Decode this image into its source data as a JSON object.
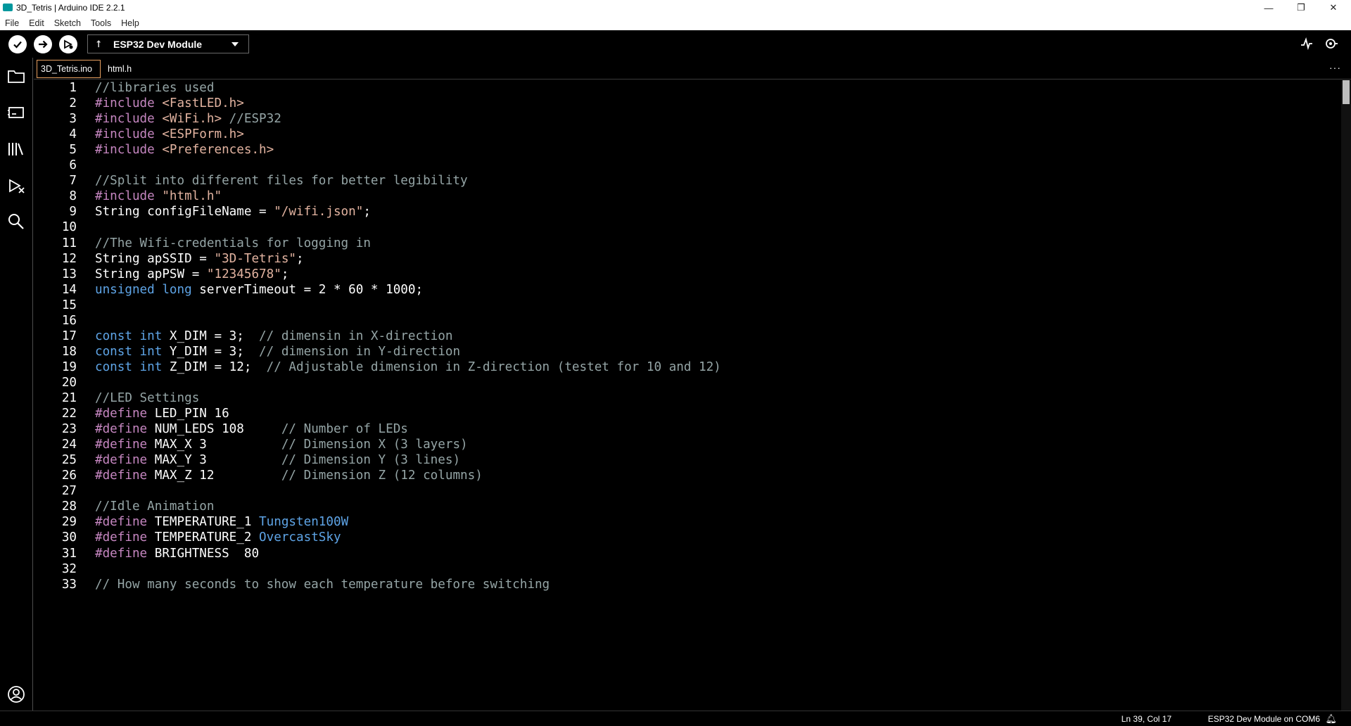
{
  "window": {
    "title": "3D_Tetris | Arduino IDE 2.2.1",
    "controls": {
      "minimize": "—",
      "maximize": "❐",
      "close": "✕"
    }
  },
  "menu": {
    "items": [
      "File",
      "Edit",
      "Sketch",
      "Tools",
      "Help"
    ]
  },
  "toolbar": {
    "verify_icon": "check-icon",
    "upload_icon": "arrow-right-icon",
    "debug_icon": "debug-icon",
    "board_label": "ESP32 Dev Module",
    "serial_plotter_icon": "plotter-icon",
    "serial_monitor_icon": "monitor-icon"
  },
  "sidebar": {
    "items": [
      "sketchbook-icon",
      "boards-manager-icon",
      "library-manager-icon",
      "debug-icon",
      "search-icon"
    ],
    "bottom": "account-icon"
  },
  "tabs": [
    {
      "label": "3D_Tetris.ino",
      "active": true
    },
    {
      "label": "html.h",
      "active": false
    }
  ],
  "tab_more": "···",
  "editor": {
    "lines": [
      {
        "n": "1",
        "t": [
          [
            "c",
            "//libraries used"
          ]
        ]
      },
      {
        "n": "2",
        "t": [
          [
            "p",
            "#include "
          ],
          [
            "s",
            "<FastLED.h>"
          ]
        ]
      },
      {
        "n": "3",
        "t": [
          [
            "p",
            "#include "
          ],
          [
            "s",
            "<WiFi.h>"
          ],
          [
            "c",
            " //ESP32"
          ]
        ]
      },
      {
        "n": "4",
        "t": [
          [
            "p",
            "#include "
          ],
          [
            "s",
            "<ESPForm.h>"
          ]
        ]
      },
      {
        "n": "5",
        "t": [
          [
            "p",
            "#include "
          ],
          [
            "s",
            "<Preferences.h>"
          ]
        ]
      },
      {
        "n": "6",
        "t": []
      },
      {
        "n": "7",
        "t": [
          [
            "c",
            "//Split into different files for better legibility"
          ]
        ]
      },
      {
        "n": "8",
        "t": [
          [
            "p",
            "#include "
          ],
          [
            "s",
            "\"html.h\""
          ]
        ]
      },
      {
        "n": "9",
        "t": [
          [
            "d",
            "String configFileName = "
          ],
          [
            "s",
            "\"/wifi.json\""
          ],
          [
            "d",
            ";"
          ]
        ]
      },
      {
        "n": "10",
        "t": []
      },
      {
        "n": "11",
        "t": [
          [
            "c",
            "//The Wifi-credentials for logging in"
          ]
        ]
      },
      {
        "n": "12",
        "t": [
          [
            "d",
            "String apSSID = "
          ],
          [
            "s",
            "\"3D-Tetris\""
          ],
          [
            "d",
            ";"
          ]
        ]
      },
      {
        "n": "13",
        "t": [
          [
            "d",
            "String apPSW = "
          ],
          [
            "s",
            "\"12345678\""
          ],
          [
            "d",
            ";"
          ]
        ]
      },
      {
        "n": "14",
        "t": [
          [
            "k",
            "unsigned long"
          ],
          [
            "d",
            " serverTimeout = 2 * 60 * 1000;"
          ]
        ]
      },
      {
        "n": "15",
        "t": []
      },
      {
        "n": "16",
        "t": []
      },
      {
        "n": "17",
        "t": [
          [
            "k",
            "const int"
          ],
          [
            "d",
            " X_DIM = 3;  "
          ],
          [
            "c",
            "// dimensin in X-direction"
          ]
        ]
      },
      {
        "n": "18",
        "t": [
          [
            "k",
            "const int"
          ],
          [
            "d",
            " Y_DIM = 3;  "
          ],
          [
            "c",
            "// dimension in Y-direction"
          ]
        ]
      },
      {
        "n": "19",
        "t": [
          [
            "k",
            "const int"
          ],
          [
            "d",
            " Z_DIM = 12;  "
          ],
          [
            "c",
            "// Adjustable dimension in Z-direction (testet for 10 and 12)"
          ]
        ]
      },
      {
        "n": "20",
        "t": []
      },
      {
        "n": "21",
        "t": [
          [
            "c",
            "//LED Settings"
          ]
        ]
      },
      {
        "n": "22",
        "t": [
          [
            "p",
            "#define"
          ],
          [
            "d",
            " LED_PIN 16"
          ]
        ]
      },
      {
        "n": "23",
        "t": [
          [
            "p",
            "#define"
          ],
          [
            "d",
            " NUM_LEDS 108     "
          ],
          [
            "c",
            "// Number of LEDs"
          ]
        ]
      },
      {
        "n": "24",
        "t": [
          [
            "p",
            "#define"
          ],
          [
            "d",
            " MAX_X 3          "
          ],
          [
            "c",
            "// Dimension X (3 layers)"
          ]
        ]
      },
      {
        "n": "25",
        "t": [
          [
            "p",
            "#define"
          ],
          [
            "d",
            " MAX_Y 3          "
          ],
          [
            "c",
            "// Dimension Y (3 lines)"
          ]
        ]
      },
      {
        "n": "26",
        "t": [
          [
            "p",
            "#define"
          ],
          [
            "d",
            " MAX_Z 12         "
          ],
          [
            "c",
            "// Dimension Z (12 columns)"
          ]
        ]
      },
      {
        "n": "27",
        "t": []
      },
      {
        "n": "28",
        "t": [
          [
            "c",
            "//Idle Animation"
          ]
        ]
      },
      {
        "n": "29",
        "t": [
          [
            "p",
            "#define"
          ],
          [
            "d",
            " TEMPERATURE_1 "
          ],
          [
            "h",
            "Tungsten100W"
          ]
        ]
      },
      {
        "n": "30",
        "t": [
          [
            "p",
            "#define"
          ],
          [
            "d",
            " TEMPERATURE_2 "
          ],
          [
            "h",
            "OvercastSky"
          ]
        ]
      },
      {
        "n": "31",
        "t": [
          [
            "p",
            "#define"
          ],
          [
            "d",
            " BRIGHTNESS  80"
          ]
        ]
      },
      {
        "n": "32",
        "t": []
      },
      {
        "n": "33",
        "t": [
          [
            "c",
            "// How many seconds to show each temperature before switching"
          ]
        ]
      }
    ]
  },
  "status": {
    "position": "Ln 39, Col 17",
    "board": "ESP32 Dev Module on COM6",
    "bell_icon": "bell-icon"
  },
  "colors": {
    "comment": "#95a5a6",
    "preprocessor": "#c586c0",
    "string": "#e2b3a0",
    "keyword": "#5ea4e6",
    "active_tab_border": "#e8a060"
  }
}
